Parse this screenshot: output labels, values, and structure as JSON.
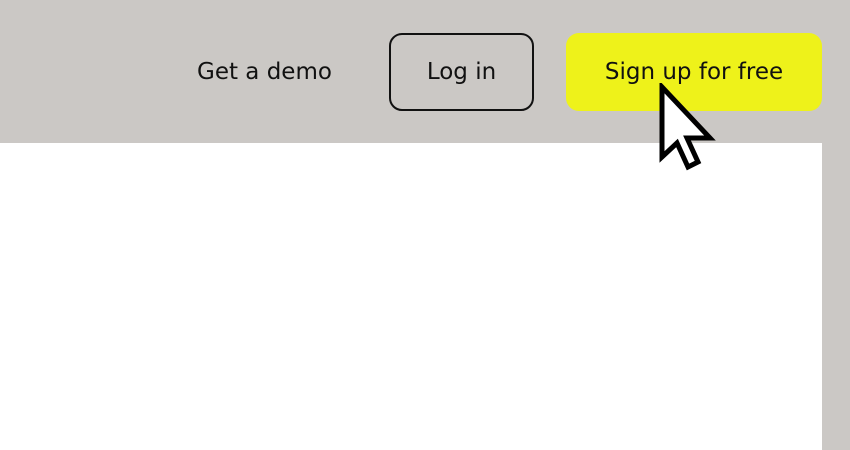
{
  "header": {
    "demo_link": "Get a demo",
    "login_label": "Log in",
    "signup_label": "Sign up for free"
  },
  "colors": {
    "background": "#cbc8c5",
    "accent": "#eef21a",
    "text": "#111111",
    "content": "#ffffff"
  },
  "icons": {
    "cursor": "mouse-pointer-arrow-icon"
  }
}
